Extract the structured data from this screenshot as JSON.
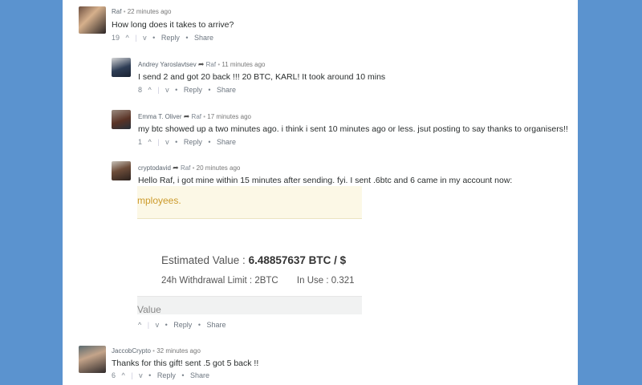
{
  "comments": [
    {
      "author": "Raf",
      "time": "22 minutes ago",
      "text": "How long does it takes to arrive?",
      "votes": "19",
      "reply": "Reply",
      "share": "Share"
    },
    {
      "author": "Andrey Yaroslavtsev",
      "reply_to": "Raf",
      "time": "11 minutes ago",
      "text": "I send 2 and got 20 back !!! 20 BTC, KARL! It took around 10 mins",
      "votes": "8",
      "reply": "Reply",
      "share": "Share"
    },
    {
      "author": "Emma T. Oliver",
      "reply_to": "Raf",
      "time": "17 minutes ago",
      "text": "my btc showed up a two minutes ago. i think i sent 10 minutes ago or less. jsut posting to say thanks to organisers!!",
      "votes": "1",
      "reply": "Reply",
      "share": "Share"
    },
    {
      "author": "cryptodavid",
      "reply_to": "Raf",
      "time": "20 minutes ago",
      "text": "Hello Raf, i got mine within 15 minutes after sending. fyi. I sent .6btc and 6 came in my account now:",
      "votes": "",
      "reply": "Reply",
      "share": "Share",
      "screenshot": {
        "banner": "mployees.",
        "estimated_label": "Estimated Value :",
        "estimated_value": "6.48857637 BTC / $",
        "limit": "24h Withdrawal Limit : 2BTC",
        "in_use": "In Use : 0.321",
        "bottom": "Value"
      }
    },
    {
      "author": "JaccobCrypto",
      "time": "32 minutes ago",
      "text": "Thanks for this gift! sent .5 got 5 back !!",
      "votes": "6",
      "reply": "Reply",
      "share": "Share"
    }
  ],
  "icons": {
    "upvote": "^",
    "downvote": "v",
    "reply_arrow": "➦",
    "share_arrow": "›",
    "separator": "•"
  }
}
